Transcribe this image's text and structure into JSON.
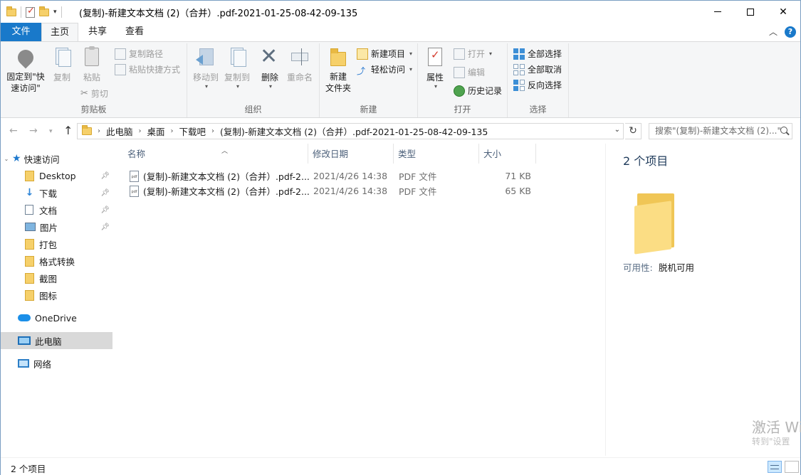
{
  "window": {
    "title": "(复制)-新建文本文档 (2)（合并）.pdf-2021-01-25-08-42-09-135"
  },
  "ribbon_tabs": {
    "file": "文件",
    "home": "主页",
    "share": "共享",
    "view": "查看"
  },
  "ribbon": {
    "clipboard": {
      "label": "剪贴板",
      "pin": "固定到\"快速访问\"",
      "copy": "复制",
      "paste": "粘贴",
      "copy_path": "复制路径",
      "paste_shortcut": "粘贴快捷方式",
      "cut": "剪切"
    },
    "organize": {
      "label": "组织",
      "move_to": "移动到",
      "copy_to": "复制到",
      "delete": "删除",
      "rename": "重命名"
    },
    "new": {
      "label": "新建",
      "new_folder_line1": "新建",
      "new_folder_line2": "文件夹",
      "new_item": "新建项目",
      "easy_access": "轻松访问"
    },
    "open": {
      "label": "打开",
      "properties": "属性",
      "open": "打开",
      "edit": "编辑",
      "history": "历史记录"
    },
    "select": {
      "label": "选择",
      "select_all": "全部选择",
      "select_none": "全部取消",
      "invert": "反向选择"
    }
  },
  "address": {
    "crumbs": [
      "此电脑",
      "桌面",
      "下载吧",
      "(复制)-新建文本文档 (2)（合并）.pdf-2021-01-25-08-42-09-135"
    ],
    "search_placeholder": "搜索\"(复制)-新建文本文档 (2)...\""
  },
  "nav": {
    "quick_access": "快速访问",
    "items": [
      {
        "label": "Desktop",
        "icon": "folder-icon",
        "pinned": true
      },
      {
        "label": "下载",
        "icon": "download-icon",
        "pinned": true
      },
      {
        "label": "文档",
        "icon": "document-icon",
        "pinned": true
      },
      {
        "label": "图片",
        "icon": "pictures-icon",
        "pinned": true
      },
      {
        "label": "打包",
        "icon": "folder-icon",
        "pinned": false
      },
      {
        "label": "格式转换",
        "icon": "folder-icon",
        "pinned": false
      },
      {
        "label": "截图",
        "icon": "folder-icon",
        "pinned": false
      },
      {
        "label": "图标",
        "icon": "folder-icon",
        "pinned": false
      }
    ],
    "onedrive": "OneDrive",
    "this_pc": "此电脑",
    "network": "网络"
  },
  "filelist": {
    "columns": [
      "名称",
      "修改日期",
      "类型",
      "大小"
    ],
    "rows": [
      {
        "name": "(复制)-新建文本文档 (2)（合并）.pdf-2...",
        "date": "2021/4/26 14:38",
        "type": "PDF 文件",
        "size": "71 KB"
      },
      {
        "name": "(复制)-新建文本文档 (2)（合并）.pdf-2...",
        "date": "2021/4/26 14:38",
        "type": "PDF 文件",
        "size": "65 KB"
      }
    ]
  },
  "details": {
    "title": "2 个项目",
    "availability_label": "可用性:",
    "availability_value": "脱机可用",
    "watermark": "激活 Wi",
    "watermark2": "转到\"设置"
  },
  "status": {
    "count": "2 个项目"
  },
  "colors": {
    "accent": "#1979ca",
    "selection": "#cce8ff",
    "folder": "#f6d06a"
  }
}
